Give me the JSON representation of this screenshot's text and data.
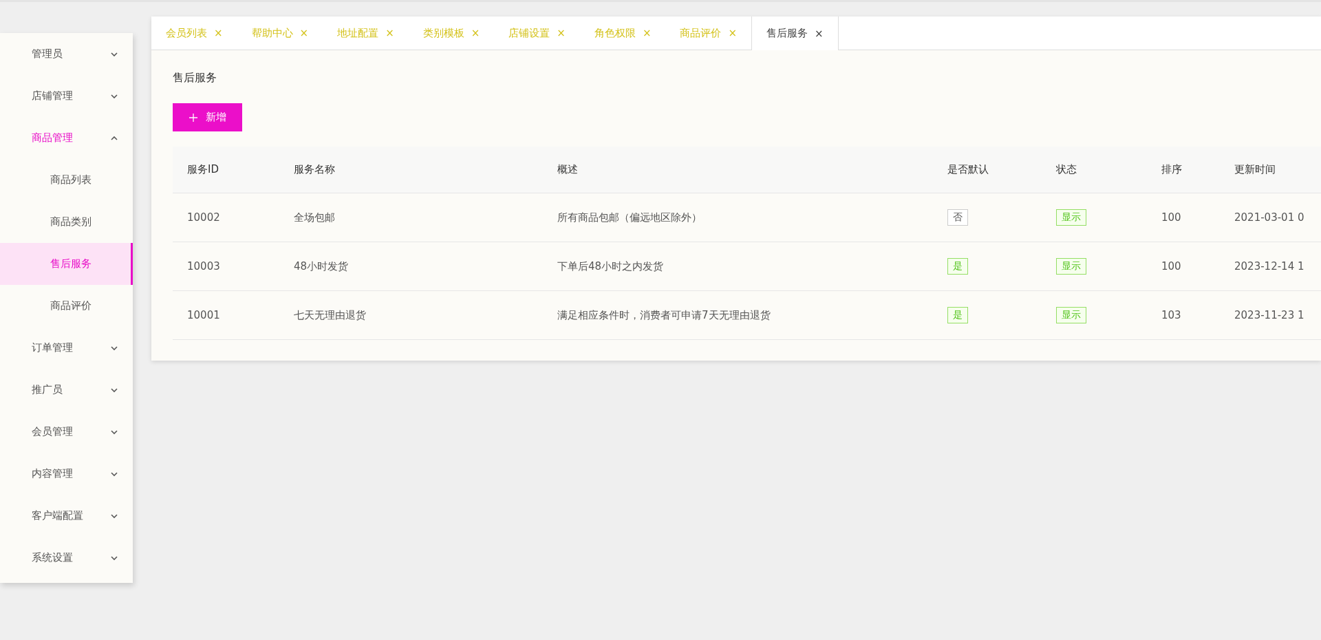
{
  "sidebar": {
    "items": [
      {
        "label": "管理员",
        "expanded": false,
        "selected": false
      },
      {
        "label": "店铺管理",
        "expanded": false,
        "selected": false
      },
      {
        "label": "商品管理",
        "expanded": true,
        "selected": true,
        "children": [
          {
            "label": "商品列表",
            "selected": false
          },
          {
            "label": "商品类别",
            "selected": false
          },
          {
            "label": "售后服务",
            "selected": true
          },
          {
            "label": "商品评价",
            "selected": false
          }
        ]
      },
      {
        "label": "订单管理",
        "expanded": false,
        "selected": false
      },
      {
        "label": "推广员",
        "expanded": false,
        "selected": false
      },
      {
        "label": "会员管理",
        "expanded": false,
        "selected": false
      },
      {
        "label": "内容管理",
        "expanded": false,
        "selected": false
      },
      {
        "label": "客户端配置",
        "expanded": false,
        "selected": false
      },
      {
        "label": "系统设置",
        "expanded": false,
        "selected": false
      }
    ]
  },
  "tabs": [
    {
      "label": "会员列表",
      "close": "×",
      "selected": false
    },
    {
      "label": "帮助中心",
      "close": "×",
      "selected": false
    },
    {
      "label": "地址配置",
      "close": "×",
      "selected": false
    },
    {
      "label": "类别模板",
      "close": "×",
      "selected": false
    },
    {
      "label": "店铺设置",
      "close": "×",
      "selected": false
    },
    {
      "label": "角色权限",
      "close": "×",
      "selected": false
    },
    {
      "label": "商品评价",
      "close": "×",
      "selected": false
    },
    {
      "label": "售后服务",
      "close": "×",
      "selected": true
    }
  ],
  "page_title": "售后服务",
  "add_button": "新增",
  "table": {
    "columns": [
      "服务ID",
      "服务名称",
      "概述",
      "是否默认",
      "状态",
      "排序",
      "更新时间"
    ],
    "rows": [
      {
        "id": "10002",
        "name": "全场包邮",
        "summary": "所有商品包邮（偏远地区除外）",
        "default": {
          "text": "否",
          "on": false
        },
        "status": {
          "text": "显示",
          "on": true
        },
        "sort": "100",
        "updated": "2021-03-01 0"
      },
      {
        "id": "10003",
        "name": "48小时发货",
        "summary": "下单后48小时之内发货",
        "default": {
          "text": "是",
          "on": true
        },
        "status": {
          "text": "显示",
          "on": true
        },
        "sort": "100",
        "updated": "2023-12-14 1"
      },
      {
        "id": "10001",
        "name": "七天无理由退货",
        "summary": "满足相应条件时，消费者可申请7天无理由退货",
        "default": {
          "text": "是",
          "on": true
        },
        "status": {
          "text": "显示",
          "on": true
        },
        "sort": "103",
        "updated": "2023-11-23 1"
      }
    ]
  }
}
